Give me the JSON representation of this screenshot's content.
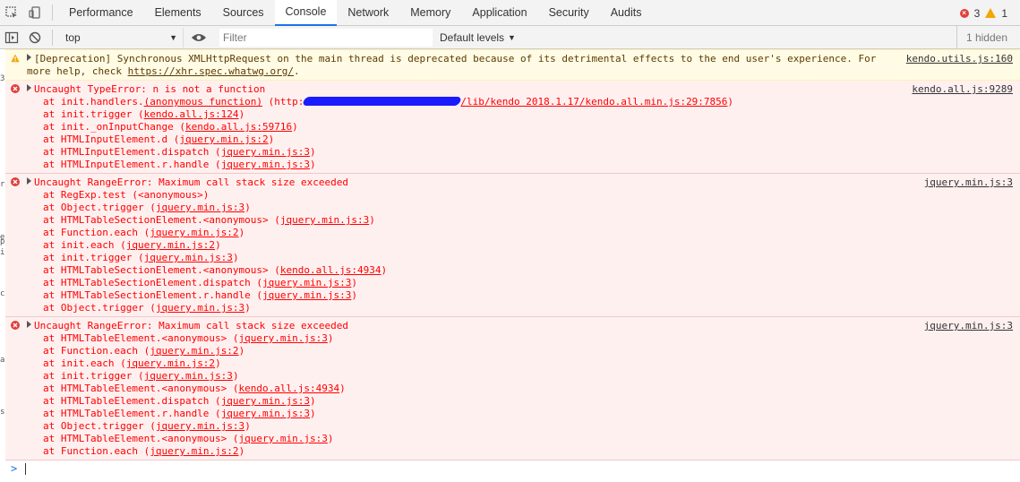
{
  "tabs": [
    "Performance",
    "Elements",
    "Sources",
    "Console",
    "Network",
    "Memory",
    "Application",
    "Security",
    "Audits"
  ],
  "active_tab": "Console",
  "counts": {
    "errors": "3",
    "warnings": "1"
  },
  "toolbar": {
    "context": "top",
    "filter_placeholder": "Filter",
    "levels": "Default levels",
    "hidden": "1 hidden"
  },
  "left_edge": [
    "3:",
    "r",
    "e",
    "p",
    "i",
    "c",
    "a",
    "s"
  ],
  "warning": {
    "line1": "[Deprecation] Synchronous XMLHttpRequest on the main thread is deprecated because of its detrimental effects to the end user's experience. For",
    "line2_prefix": "more help, check ",
    "line2_link": "https://xhr.spec.whatwg.org/",
    "line2_suffix": ".",
    "source": "kendo.utils.js:160"
  },
  "errors": [
    {
      "title": "Uncaught TypeError: n is not a function",
      "source": "kendo.all.js:9289",
      "frames": [
        {
          "text": "at init.handlers.",
          "link": "(anonymous function)",
          "link2_pre": " (http:",
          "link2": "/lib/kendo 2018.1.17/kendo.all.min.js:29:7856",
          "suffix": ")",
          "redacted": true
        },
        {
          "text": "at init.trigger (",
          "link": "kendo.all.js:124",
          "suffix": ")"
        },
        {
          "text": "at init._onInputChange (",
          "link": "kendo.all.js:59716",
          "suffix": ")"
        },
        {
          "text": "at HTMLInputElement.d (",
          "link": "jquery.min.js:2",
          "suffix": ")"
        },
        {
          "text": "at HTMLInputElement.dispatch (",
          "link": "jquery.min.js:3",
          "suffix": ")"
        },
        {
          "text": "at HTMLInputElement.r.handle (",
          "link": "jquery.min.js:3",
          "suffix": ")"
        }
      ]
    },
    {
      "title": "Uncaught RangeError: Maximum call stack size exceeded",
      "source": "jquery.min.js:3",
      "frames": [
        {
          "text": "at RegExp.test (<anonymous>)",
          "link": "",
          "suffix": ""
        },
        {
          "text": "at Object.trigger (",
          "link": "jquery.min.js:3",
          "suffix": ")"
        },
        {
          "text": "at HTMLTableSectionElement.<anonymous> (",
          "link": "jquery.min.js:3",
          "suffix": ")"
        },
        {
          "text": "at Function.each (",
          "link": "jquery.min.js:2",
          "suffix": ")"
        },
        {
          "text": "at init.each (",
          "link": "jquery.min.js:2",
          "suffix": ")"
        },
        {
          "text": "at init.trigger (",
          "link": "jquery.min.js:3",
          "suffix": ")"
        },
        {
          "text": "at HTMLTableSectionElement.<anonymous> (",
          "link": "kendo.all.js:4934",
          "suffix": ")"
        },
        {
          "text": "at HTMLTableSectionElement.dispatch (",
          "link": "jquery.min.js:3",
          "suffix": ")"
        },
        {
          "text": "at HTMLTableSectionElement.r.handle (",
          "link": "jquery.min.js:3",
          "suffix": ")"
        },
        {
          "text": "at Object.trigger (",
          "link": "jquery.min.js:3",
          "suffix": ")"
        }
      ]
    },
    {
      "title": "Uncaught RangeError: Maximum call stack size exceeded",
      "source": "jquery.min.js:3",
      "frames": [
        {
          "text": "at HTMLTableElement.<anonymous> (",
          "link": "jquery.min.js:3",
          "suffix": ")"
        },
        {
          "text": "at Function.each (",
          "link": "jquery.min.js:2",
          "suffix": ")"
        },
        {
          "text": "at init.each (",
          "link": "jquery.min.js:2",
          "suffix": ")"
        },
        {
          "text": "at init.trigger (",
          "link": "jquery.min.js:3",
          "suffix": ")"
        },
        {
          "text": "at HTMLTableElement.<anonymous> (",
          "link": "kendo.all.js:4934",
          "suffix": ")"
        },
        {
          "text": "at HTMLTableElement.dispatch (",
          "link": "jquery.min.js:3",
          "suffix": ")"
        },
        {
          "text": "at HTMLTableElement.r.handle (",
          "link": "jquery.min.js:3",
          "suffix": ")"
        },
        {
          "text": "at Object.trigger (",
          "link": "jquery.min.js:3",
          "suffix": ")"
        },
        {
          "text": "at HTMLTableElement.<anonymous> (",
          "link": "jquery.min.js:3",
          "suffix": ")"
        },
        {
          "text": "at Function.each (",
          "link": "jquery.min.js:2",
          "suffix": ")"
        }
      ]
    }
  ],
  "prompt_symbol": ">",
  "colors": {
    "error_bg": "#fff0f0",
    "error_text": "#ff0000",
    "warning_bg": "#fffbe5",
    "active_tab": "#1a73e8",
    "redaction": "#1b1bff"
  }
}
